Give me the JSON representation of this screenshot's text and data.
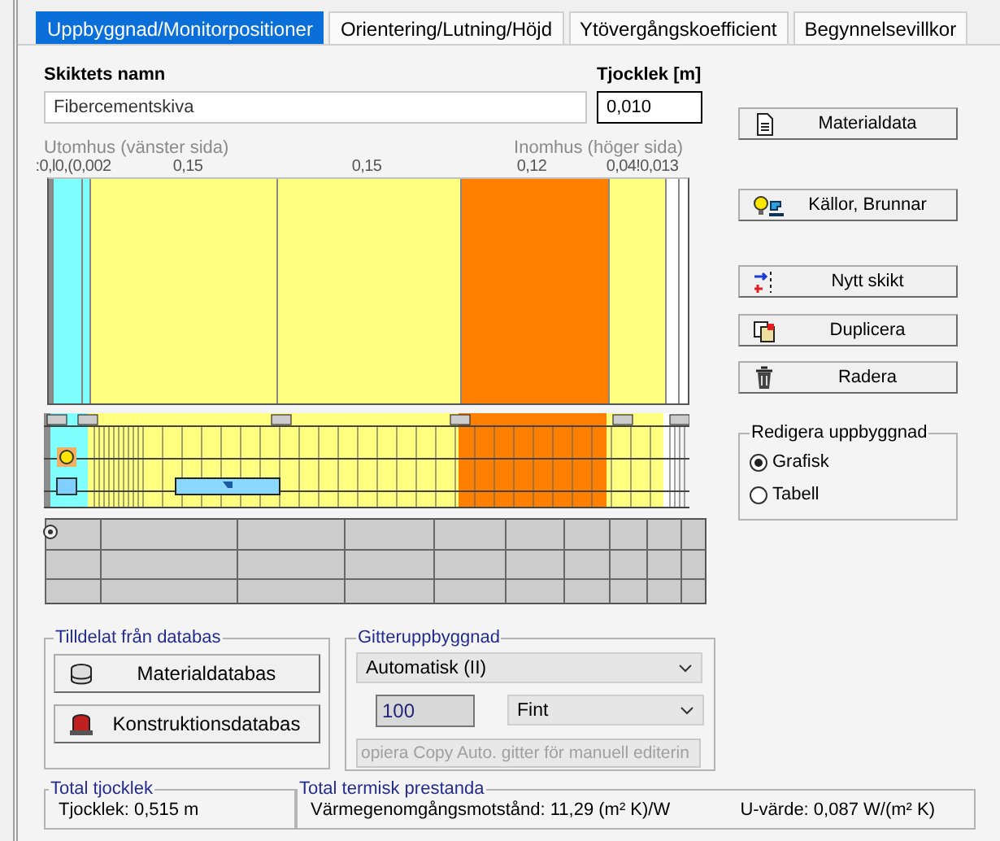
{
  "tabs": [
    {
      "label": "Uppbyggnad/Monitorpositioner",
      "selected": true
    },
    {
      "label": "Orientering/Lutning/Höjd",
      "selected": false
    },
    {
      "label": "Ytövergångskoefficient",
      "selected": false
    },
    {
      "label": "Begynnelsevillkor",
      "selected": false
    }
  ],
  "layer_name": {
    "label": "Skiktets namn",
    "value": "Fibercementskiva"
  },
  "thickness": {
    "label": "Tjocklek [m]",
    "value": "0,010"
  },
  "structure": {
    "outside_label": "Utomhus (vänster sida)",
    "inside_label": "Inomhus (höger sida)",
    "thickness_labels": [
      ":0,l0,(0,002",
      "0,15",
      "0,15",
      "0,12",
      "0,04!0,013"
    ],
    "layers": [
      {
        "color": "#8c8c8c"
      },
      {
        "color": "#80ffff"
      },
      {
        "color": "#80ffff"
      },
      {
        "color": "#ffff80"
      },
      {
        "color": "#ffff80"
      },
      {
        "color": "#ff8000"
      },
      {
        "color": "#ffff80"
      },
      {
        "color": "#ffffff"
      }
    ]
  },
  "actions": [
    {
      "label": "Materialdata",
      "kind": "document"
    },
    {
      "label": "Källor, Brunnar",
      "kind": "sources"
    },
    {
      "label": "Nytt skikt",
      "kind": "new"
    },
    {
      "label": "Duplicera",
      "kind": "duplicate"
    },
    {
      "label": "Radera",
      "kind": "delete"
    }
  ],
  "edit_mode": {
    "title": "Redigera uppbyggnad",
    "options": [
      {
        "label": "Grafisk",
        "selected": true
      },
      {
        "label": "Tabell",
        "selected": false
      }
    ]
  },
  "database": {
    "title": "Tilldelat från databas",
    "buttons": [
      {
        "label": "Materialdatabas",
        "kind": "material"
      },
      {
        "label": "Konstruktionsdatabas",
        "kind": "construction"
      }
    ]
  },
  "grid": {
    "title": "Gitteruppbyggnad",
    "mode": "Automatisk (II)",
    "count": "100",
    "density": "Fint",
    "copy_button": "opiera Copy Auto. gitter för manuell editerin",
    "copy_disabled": true
  },
  "total_thickness": {
    "title": "Total tjocklek",
    "text": "Tjocklek: 0,515 m"
  },
  "thermal": {
    "title": "Total termisk prestanda",
    "resistance": "Värmegenomgångsmotstånd: 11,29 (m² K)/W",
    "u_value": "U-värde: 0,087 W/(m² K)"
  }
}
